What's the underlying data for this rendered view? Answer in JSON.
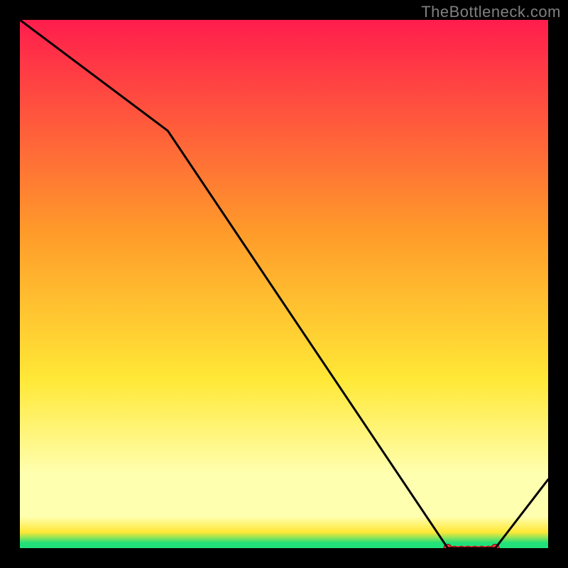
{
  "attribution": "TheBottleneck.com",
  "colors": {
    "background": "#000000",
    "top_gradient": "#ff1d4d",
    "mid1_gradient": "#ff9a2a",
    "mid2_gradient": "#ffe836",
    "pale_band": "#ffffb0",
    "green_band": "#22e07a",
    "line": "#000000",
    "marker_fill": "#ff3b3b",
    "marker_stroke": "#7a0010"
  },
  "chart_data": {
    "type": "line",
    "x": [
      0,
      28,
      81,
      90,
      100
    ],
    "values": [
      100,
      79,
      0,
      0,
      13
    ],
    "xlabel": "",
    "ylabel": "",
    "xlim": [
      0,
      100
    ],
    "ylim": [
      0,
      100
    ],
    "title": "",
    "marker_band": {
      "x_start": 81,
      "x_end": 90,
      "y": 0
    }
  }
}
